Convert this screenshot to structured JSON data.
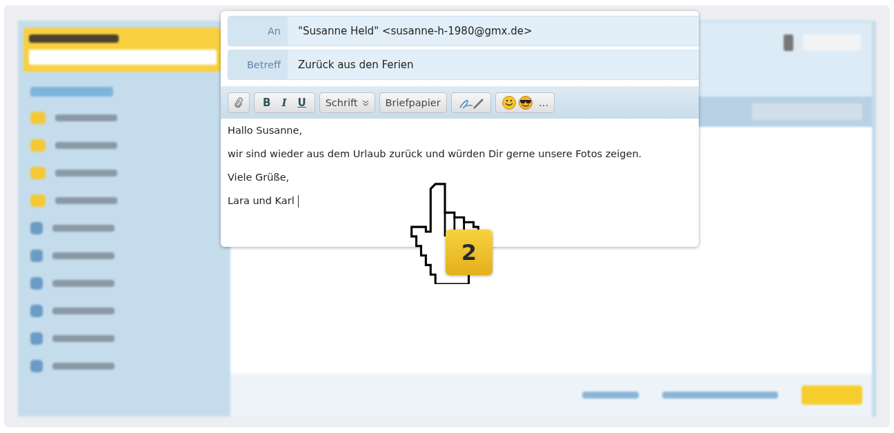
{
  "compose": {
    "fields": [
      {
        "label": "An",
        "value": "\"Susanne Held\" <susanne-h-1980@gmx.de>"
      },
      {
        "label": "Betreff",
        "value": "Zurück aus den Ferien"
      }
    ],
    "toolbar": [
      {
        "kind": "attach"
      },
      {
        "kind": "format",
        "labels": [
          "B",
          "I",
          "U"
        ]
      },
      {
        "kind": "dropdown",
        "label": "Schrift"
      },
      {
        "kind": "button",
        "label": "Briefpapier"
      },
      {
        "kind": "signature"
      },
      {
        "kind": "emoticons",
        "label": "…"
      }
    ],
    "body": {
      "lines": [
        "Hallo Susanne,",
        "wir sind wieder aus dem Urlaub zurück und würden Dir gerne unsere Fotos zeigen.",
        "Viele Grüße,",
        "Lara und Karl"
      ],
      "text_cursor": true
    }
  },
  "step_badge": "2"
}
